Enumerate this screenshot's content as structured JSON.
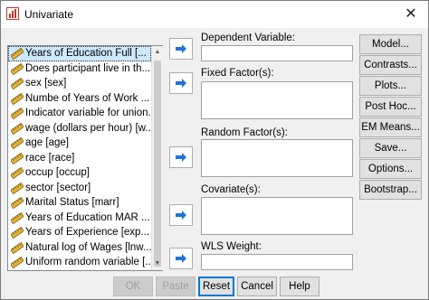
{
  "window": {
    "title": "Univariate",
    "close_glyph": "✕"
  },
  "variables": [
    "Years of Education Full [...",
    "Does participant live in th...",
    "sex [sex]",
    "Numbe of Years of Work ...",
    "Indicator variable for union...",
    "wage (dollars per hour) [w...",
    "age [age]",
    "race [race]",
    "occup [occup]",
    "sector [sector]",
    "Marital Status [marr]",
    "Years of Education MAR ...",
    "Years of Experience [exp...",
    "Natural log of Wages [lnw...",
    "Uniform random variable [..."
  ],
  "fields": {
    "dependent": {
      "label": "Dependent Variable:",
      "value": ""
    },
    "fixed": {
      "label": "Fixed Factor(s):"
    },
    "random": {
      "label": "Random Factor(s):"
    },
    "covariate": {
      "label": "Covariate(s):"
    },
    "wls": {
      "label": "WLS Weight:",
      "value": ""
    }
  },
  "side_buttons": {
    "model": "Model...",
    "contrasts": "Contrasts...",
    "plots": "Plots...",
    "posthoc": "Post Hoc...",
    "emmeans": "EM Means...",
    "save": "Save...",
    "options": "Options...",
    "bootstrap": "Bootstrap..."
  },
  "bottom_buttons": {
    "ok": "OK",
    "paste": "Paste",
    "reset": "Reset",
    "cancel": "Cancel",
    "help": "Help"
  },
  "colors": {
    "accent": "#0078d7",
    "selection": "#cde8ff",
    "ruler": "#e8b83a"
  }
}
